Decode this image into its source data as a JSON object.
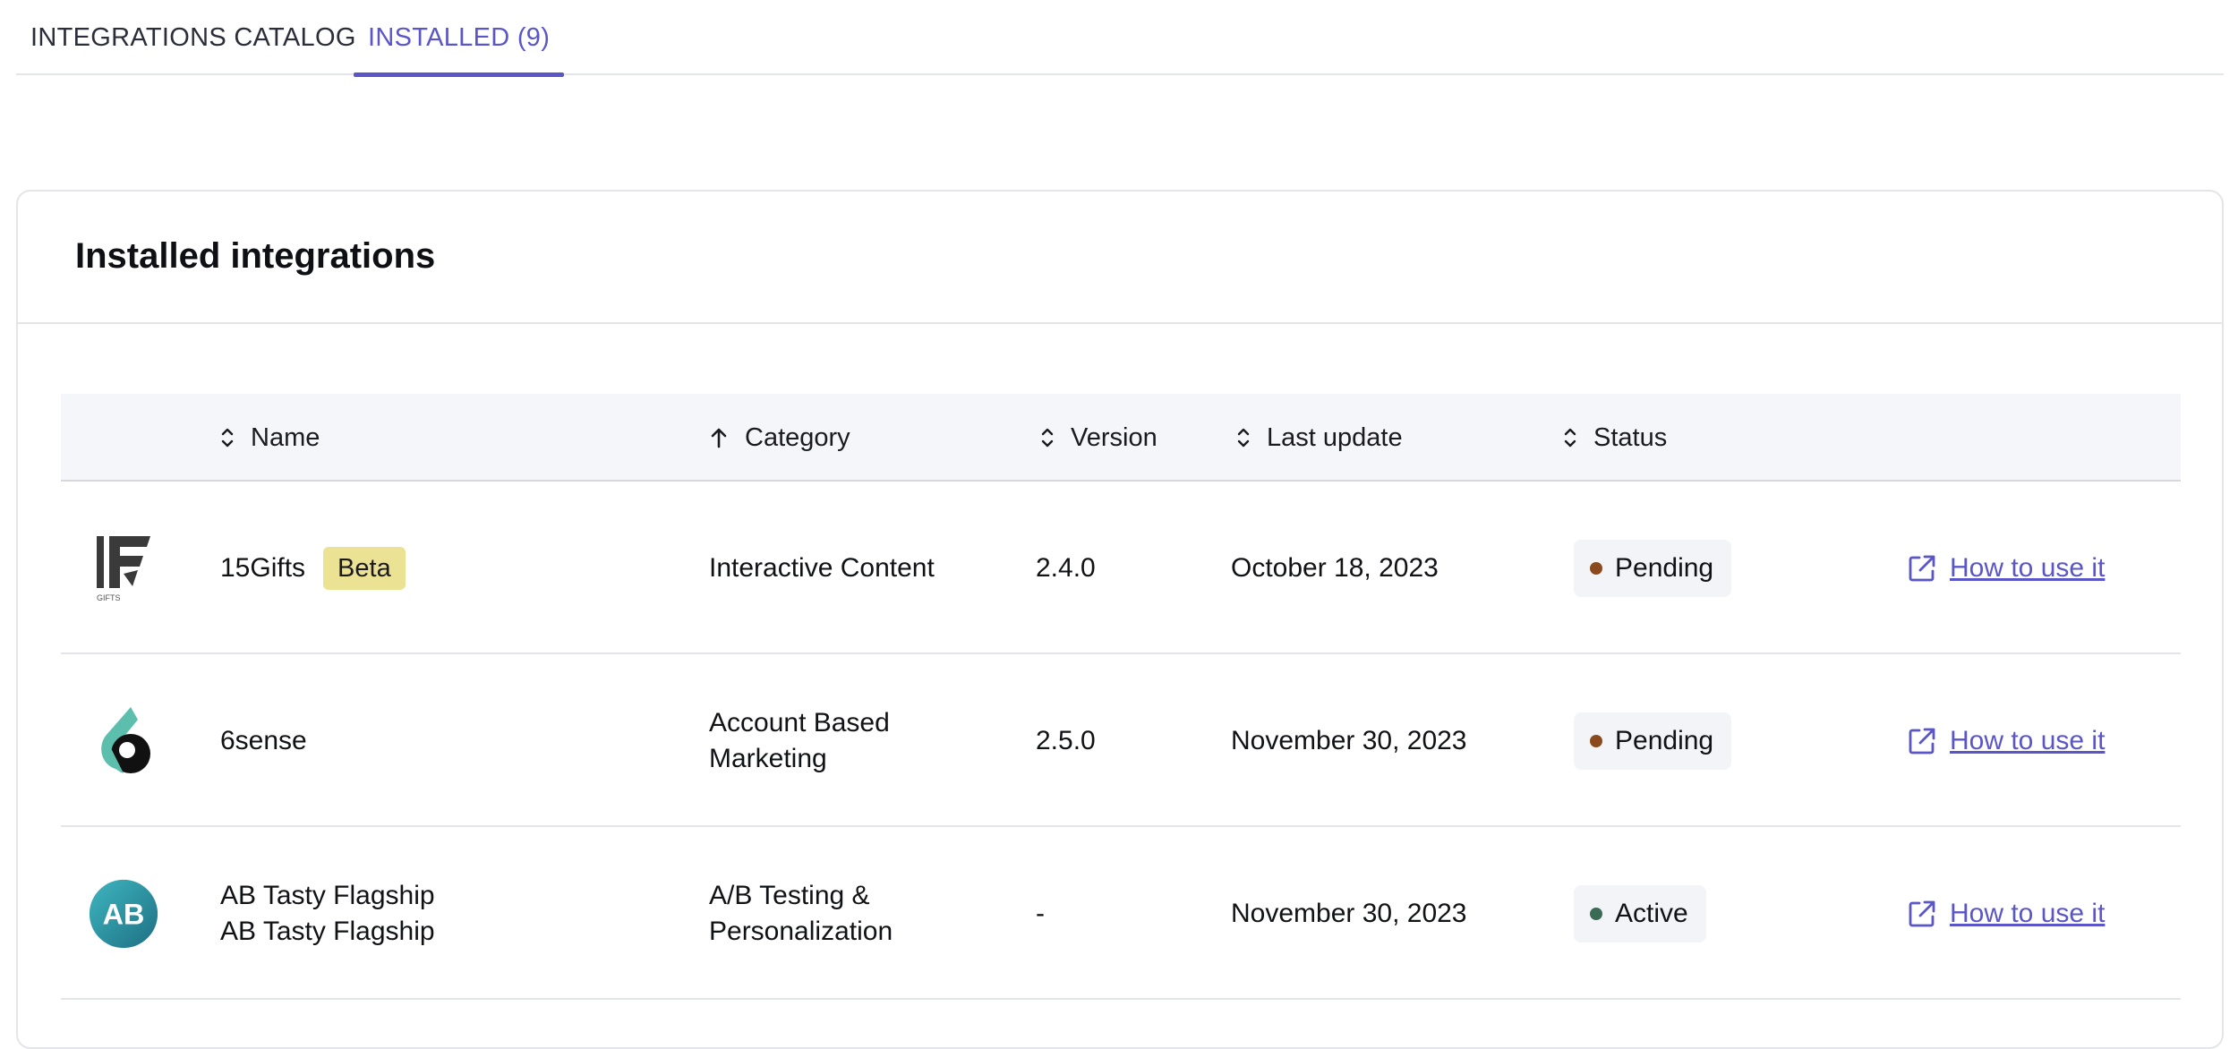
{
  "tabs": {
    "catalog": "INTEGRATIONS CATALOG",
    "installed": "INSTALLED (9)"
  },
  "card": {
    "title": "Installed integrations"
  },
  "table": {
    "headers": {
      "name": "Name",
      "category": "Category",
      "version": "Version",
      "last_update": "Last update",
      "status": "Status"
    },
    "sort": {
      "name": "unsorted",
      "category": "ascending",
      "version": "unsorted",
      "last_update": "unsorted",
      "status": "unsorted"
    },
    "rows": [
      {
        "logo": "15gifts-logo",
        "name": "15Gifts",
        "badge": "Beta",
        "category_line1": "Interactive Content",
        "category_line2": "",
        "version": "2.4.0",
        "last_update": "October 18, 2023",
        "status": "Pending",
        "status_color": "#8a4a1e",
        "link": "How to use it"
      },
      {
        "logo": "6sense-logo",
        "name": "6sense",
        "badge": "",
        "category_line1": "Account Based",
        "category_line2": "Marketing",
        "version": "2.5.0",
        "last_update": "November 30, 2023",
        "status": "Pending",
        "status_color": "#8a4a1e",
        "link": "How to use it"
      },
      {
        "logo": "ab-tasty-logo",
        "name": "AB Tasty Flagship",
        "name_line2": "AB Tasty Flagship",
        "badge": "",
        "category_line1": "A/B Testing &",
        "category_line2": "Personalization",
        "version": "-",
        "last_update": "November 30, 2023",
        "status": "Active",
        "status_color": "#3c6b55",
        "link": "How to use it"
      }
    ]
  },
  "colors": {
    "accent": "#5a56c8",
    "beta_badge": "#ece293",
    "header_bg": "#f5f6fa",
    "pill_bg": "#f3f4f7"
  }
}
